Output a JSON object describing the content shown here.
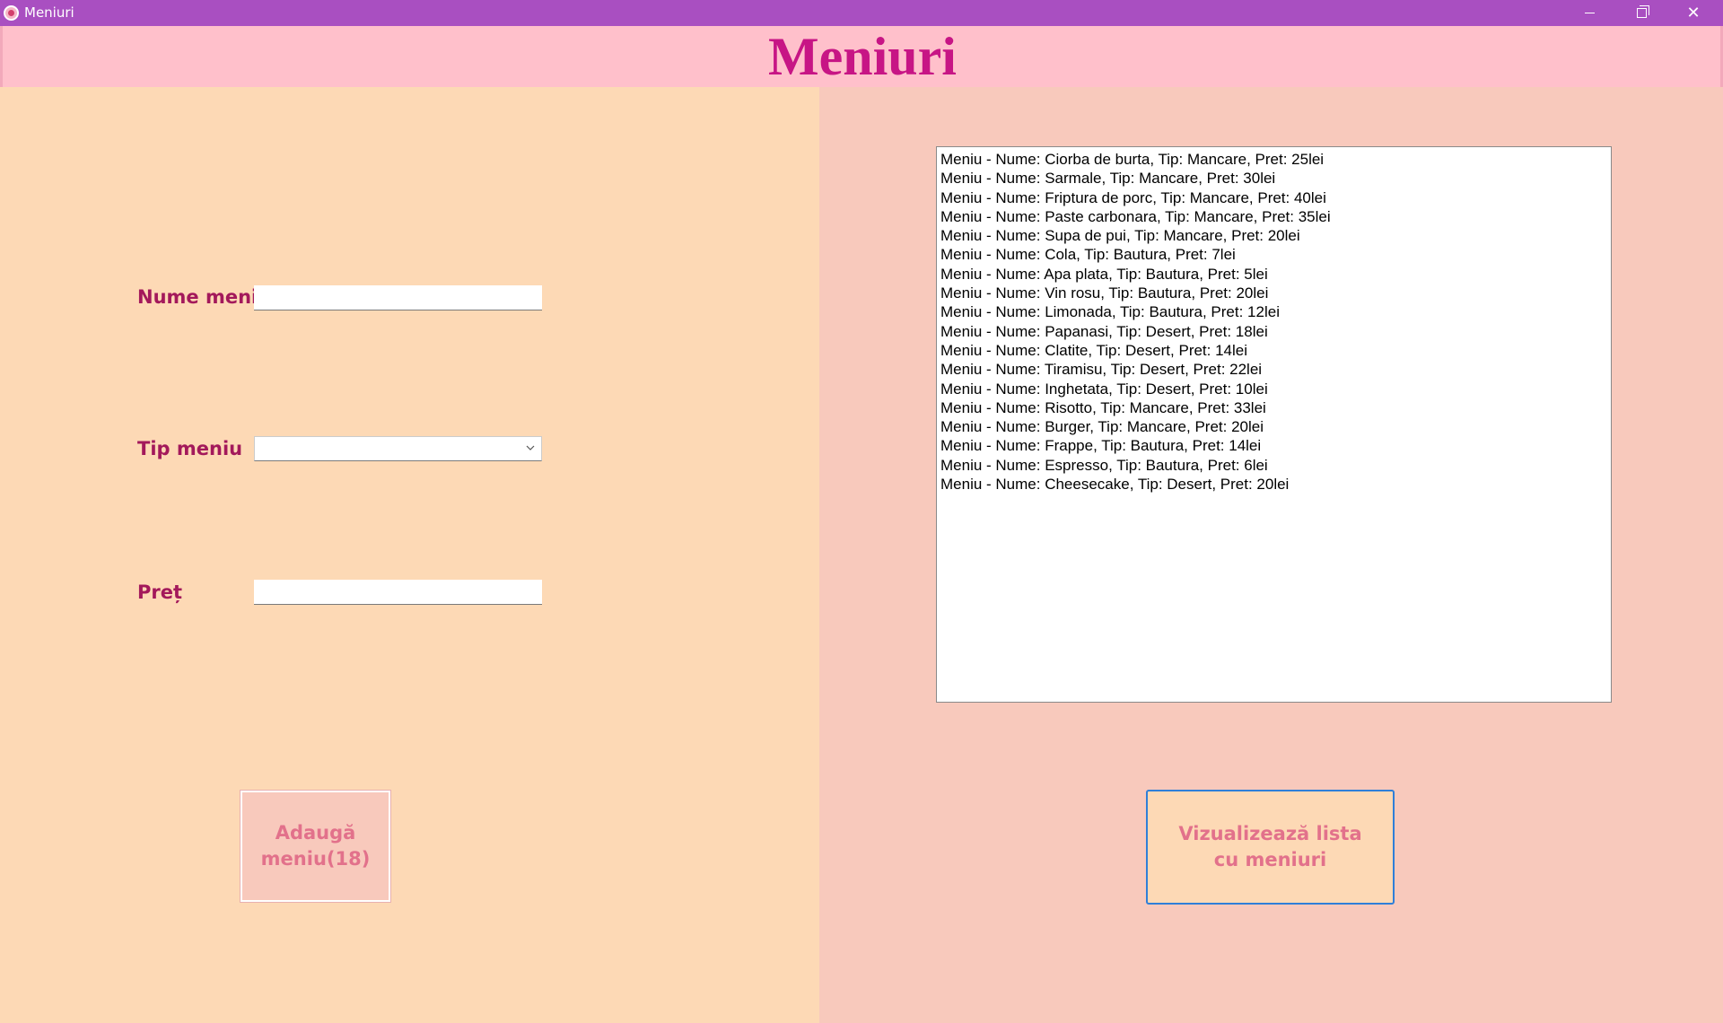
{
  "window": {
    "title": "Meniuri"
  },
  "header": {
    "title": "Meniuri"
  },
  "form": {
    "name_label": "Nume meniu",
    "name_value": "",
    "type_label": "Tip meniu",
    "type_value": "",
    "price_label": "Preț",
    "price_value": "",
    "add_button_label": "Adaugă meniu(18)"
  },
  "menu_list": {
    "items": [
      "Meniu - Nume: Ciorba de burta, Tip: Mancare, Pret: 25lei",
      "Meniu - Nume: Sarmale, Tip: Mancare, Pret: 30lei",
      "Meniu - Nume: Friptura de porc, Tip: Mancare, Pret: 40lei",
      "Meniu - Nume: Paste carbonara, Tip: Mancare, Pret: 35lei",
      "Meniu - Nume: Supa de pui, Tip: Mancare, Pret: 20lei",
      "Meniu - Nume: Cola, Tip: Bautura, Pret: 7lei",
      "Meniu - Nume: Apa plata, Tip: Bautura, Pret: 5lei",
      "Meniu - Nume: Vin rosu, Tip: Bautura, Pret: 20lei",
      "Meniu - Nume: Limonada, Tip: Bautura, Pret: 12lei",
      "Meniu - Nume: Papanasi, Tip: Desert, Pret: 18lei",
      "Meniu - Nume: Clatite, Tip: Desert, Pret: 14lei",
      "Meniu - Nume: Tiramisu, Tip: Desert, Pret: 22lei",
      "Meniu - Nume: Inghetata, Tip: Desert, Pret: 10lei",
      "Meniu - Nume: Risotto, Tip: Mancare, Pret: 33lei",
      "Meniu - Nume: Burger, Tip: Mancare, Pret: 20lei",
      "Meniu - Nume: Frappe, Tip: Bautura, Pret: 14lei",
      "Meniu - Nume: Espresso, Tip: Bautura, Pret: 6lei",
      "Meniu - Nume: Cheesecake, Tip: Desert, Pret: 20lei"
    ],
    "view_button_label": "Vizualizează lista cu meniuri"
  },
  "colors": {
    "titlebar": "#a94fc1",
    "header_bg": "#ffc0cb",
    "title_text": "#c71585",
    "left_panel": "#fdd9b5",
    "right_panel": "#f8c9bc",
    "label_text": "#a3195b",
    "button_text": "#e2718b",
    "focus_border": "#2f7fd8"
  },
  "icons": {
    "app": "heart-app-icon",
    "minimize": "minimize-icon",
    "maximize": "restore-icon",
    "close": "close-icon",
    "dropdown": "chevron-down-icon"
  }
}
